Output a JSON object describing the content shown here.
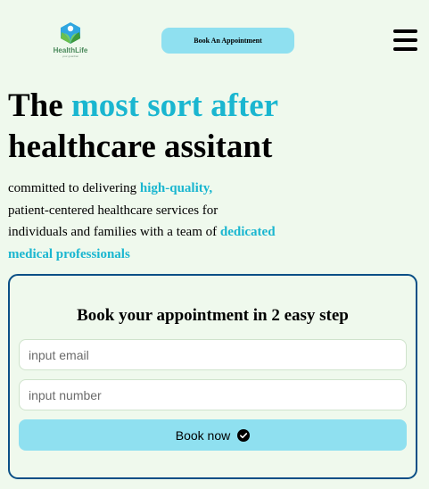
{
  "header": {
    "logo": {
      "name": "HealthLife",
      "tagline": "your guardian",
      "icon": "healthlife-logo"
    },
    "cta_label": "Book An Appointment",
    "menu_icon": "hamburger-menu-icon"
  },
  "hero": {
    "title_part1": "The ",
    "title_accent": "most sort after",
    "title_part2": "healthcare assitant",
    "desc_part1": "committed to delivering ",
    "desc_highlight1": "high-quality,",
    "desc_part2": "patient-centered healthcare services for individuals and families with a team of ",
    "desc_highlight2": "dedicated medical professionals"
  },
  "booking": {
    "title": "Book your appointment in 2 easy step",
    "email_placeholder": "input email",
    "number_placeholder": "input number",
    "button_label": "Book now",
    "button_icon": "check-circle-icon"
  },
  "colors": {
    "background": "#eff9ed",
    "accent": "#1ab6d0",
    "button": "#8fe0f0",
    "card_border": "#0a4f86"
  }
}
